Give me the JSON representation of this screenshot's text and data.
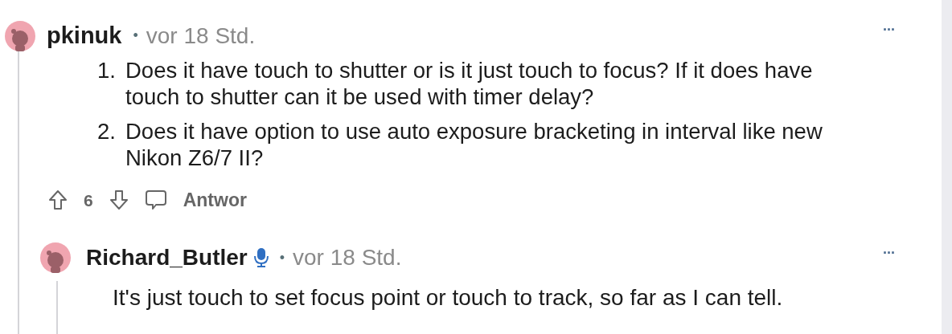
{
  "comment": {
    "author": "pkinuk",
    "separator": "•",
    "time": "vor 18 Std.",
    "more": "···",
    "items": [
      "Does it have touch to shutter or is it just touch to focus? If it does have touch to shutter can it be used with timer delay?",
      "Does it have option to use auto exposure bracketing in interval like new Nikon Z6/7 II?"
    ],
    "numbers": [
      "1.",
      "2."
    ],
    "score": "6",
    "reply_label": "Antwor"
  },
  "reply": {
    "author": "Richard_Butler",
    "mic_badge": true,
    "separator": "•",
    "time": "vor 18 Std.",
    "more": "···",
    "text": "It's just touch to set focus point or touch to track, so far as I can tell."
  }
}
